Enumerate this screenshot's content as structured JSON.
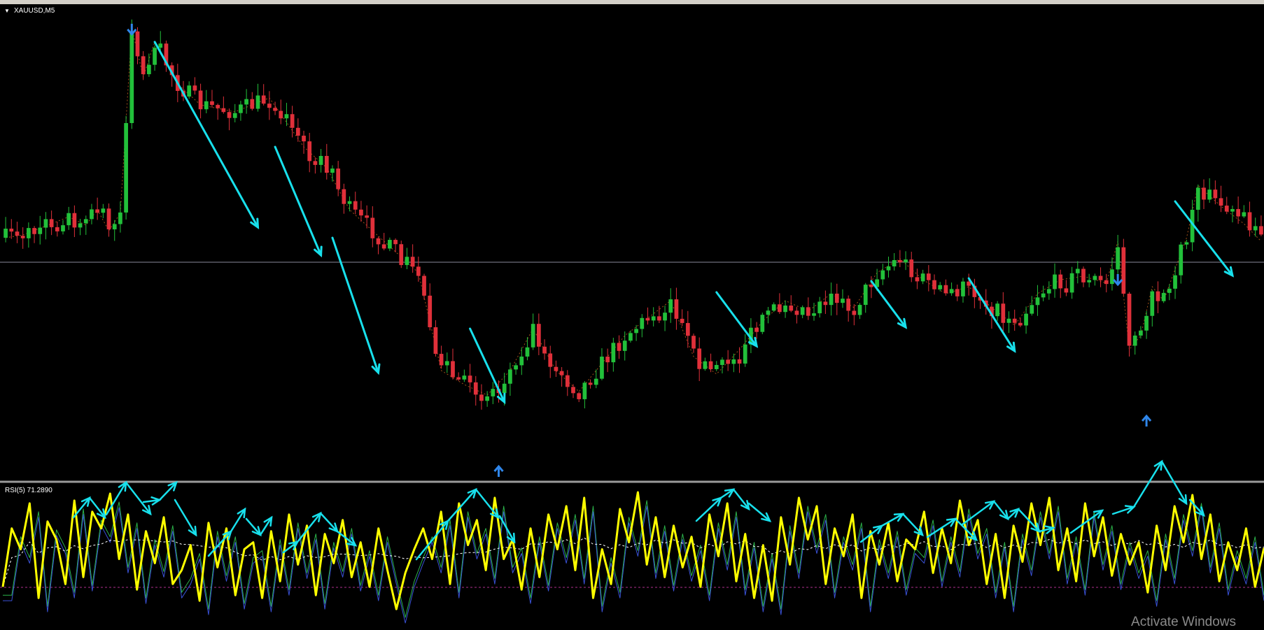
{
  "symbol_label": "XAUUSD,M5",
  "rsi_label": "RSI(5) 71.2890",
  "watermark": "Activate Windows",
  "colors": {
    "background": "#000000",
    "bull": "#22c03a",
    "bear": "#e0303a",
    "arrow": "#18e0ec",
    "signal": "#2f86ea",
    "rsi": "#ffff00",
    "rsi_ma": "#ffffff",
    "rsi_green": "#2bb24a",
    "rsi_blue": "#3a52d8",
    "hline": "#8a8a9a",
    "zigzag": "#c8641e"
  },
  "chart_data": [
    {
      "type": "candlestick",
      "title": "XAUUSD,M5",
      "price_anchors": [
        [
          0,
          340
        ],
        [
          3,
          336
        ],
        [
          8,
          320
        ],
        [
          11,
          310
        ],
        [
          14,
          322
        ],
        [
          16,
          300
        ],
        [
          18,
          330
        ],
        [
          20,
          305
        ],
        [
          22,
          40
        ],
        [
          24,
          110
        ],
        [
          26,
          60
        ],
        [
          30,
          120
        ],
        [
          34,
          150
        ],
        [
          40,
          160
        ],
        [
          46,
          140
        ],
        [
          52,
          210
        ],
        [
          56,
          240
        ],
        [
          60,
          300
        ],
        [
          64,
          330
        ],
        [
          68,
          360
        ],
        [
          72,
          390
        ],
        [
          76,
          530
        ],
        [
          80,
          550
        ],
        [
          84,
          565
        ],
        [
          88,
          530
        ],
        [
          92,
          470
        ],
        [
          96,
          530
        ],
        [
          100,
          560
        ],
        [
          104,
          520
        ],
        [
          108,
          480
        ],
        [
          112,
          455
        ],
        [
          116,
          430
        ],
        [
          120,
          510
        ],
        [
          124,
          535
        ],
        [
          128,
          500
        ],
        [
          132,
          460
        ],
        [
          136,
          430
        ],
        [
          140,
          445
        ],
        [
          144,
          420
        ],
        [
          148,
          440
        ],
        [
          152,
          390
        ],
        [
          156,
          370
        ],
        [
          160,
          400
        ],
        [
          164,
          420
        ],
        [
          168,
          410
        ],
        [
          172,
          440
        ],
        [
          176,
          465
        ],
        [
          180,
          420
        ],
        [
          184,
          400
        ],
        [
          188,
          395
        ],
        [
          192,
          405
        ],
        [
          194,
          345
        ],
        [
          196,
          500
        ],
        [
          198,
          480
        ],
        [
          200,
          410
        ],
        [
          202,
          430
        ],
        [
          206,
          340
        ],
        [
          208,
          265
        ],
        [
          212,
          295
        ],
        [
          216,
          320
        ],
        [
          219,
          345
        ]
      ],
      "signal_arrows": [
        {
          "bar": 22,
          "direction": "down"
        },
        {
          "bar": 86,
          "direction": "up"
        },
        {
          "bar": 194,
          "direction": "down"
        },
        {
          "bar": 199,
          "direction": "up"
        }
      ],
      "trend_arrows": [
        [
          26,
          60,
          44,
          325
        ],
        [
          47,
          210,
          55,
          365
        ],
        [
          57,
          340,
          65,
          533
        ],
        [
          81,
          470,
          87,
          575
        ],
        [
          124,
          418,
          131,
          495
        ],
        [
          151,
          402,
          157,
          468
        ],
        [
          168,
          398,
          176,
          502
        ],
        [
          204,
          288,
          214,
          394
        ]
      ]
    },
    {
      "type": "line",
      "title": "RSI(5) 71.2890",
      "series": [
        {
          "name": "RSI(5)",
          "values": [
            28,
            70,
            55,
            88,
            20,
            75,
            62,
            30,
            90,
            35,
            82,
            70,
            95,
            48,
            80,
            26,
            68,
            45,
            78,
            30,
            40,
            58,
            18,
            74,
            42,
            70,
            22,
            55,
            60,
            20,
            68,
            32,
            80,
            44,
            72,
            22,
            66,
            45,
            76,
            35,
            60,
            28,
            70,
            40,
            12,
            38,
            55,
            70,
            48,
            82,
            30,
            88,
            58,
            76,
            40,
            92,
            48,
            62,
            26,
            70,
            35,
            80,
            55,
            86,
            40,
            92,
            20,
            55,
            30,
            84,
            60,
            96,
            44,
            78,
            35,
            72,
            42,
            64,
            28,
            80,
            50,
            88,
            32,
            66,
            20,
            58,
            18,
            78,
            44,
            92,
            62,
            86,
            30,
            70,
            50,
            80,
            20,
            68,
            44,
            74,
            32,
            62,
            55,
            82,
            38,
            70,
            45,
            90,
            58,
            76,
            30,
            66,
            20,
            72,
            46,
            88,
            58,
            92,
            40,
            70,
            32,
            88,
            50,
            78,
            36,
            66,
            44,
            60,
            24,
            72,
            40,
            86,
            60,
            94,
            48,
            80,
            32,
            60,
            40,
            70,
            28,
            56
          ]
        }
      ],
      "ylim": [
        0,
        100
      ]
    }
  ]
}
